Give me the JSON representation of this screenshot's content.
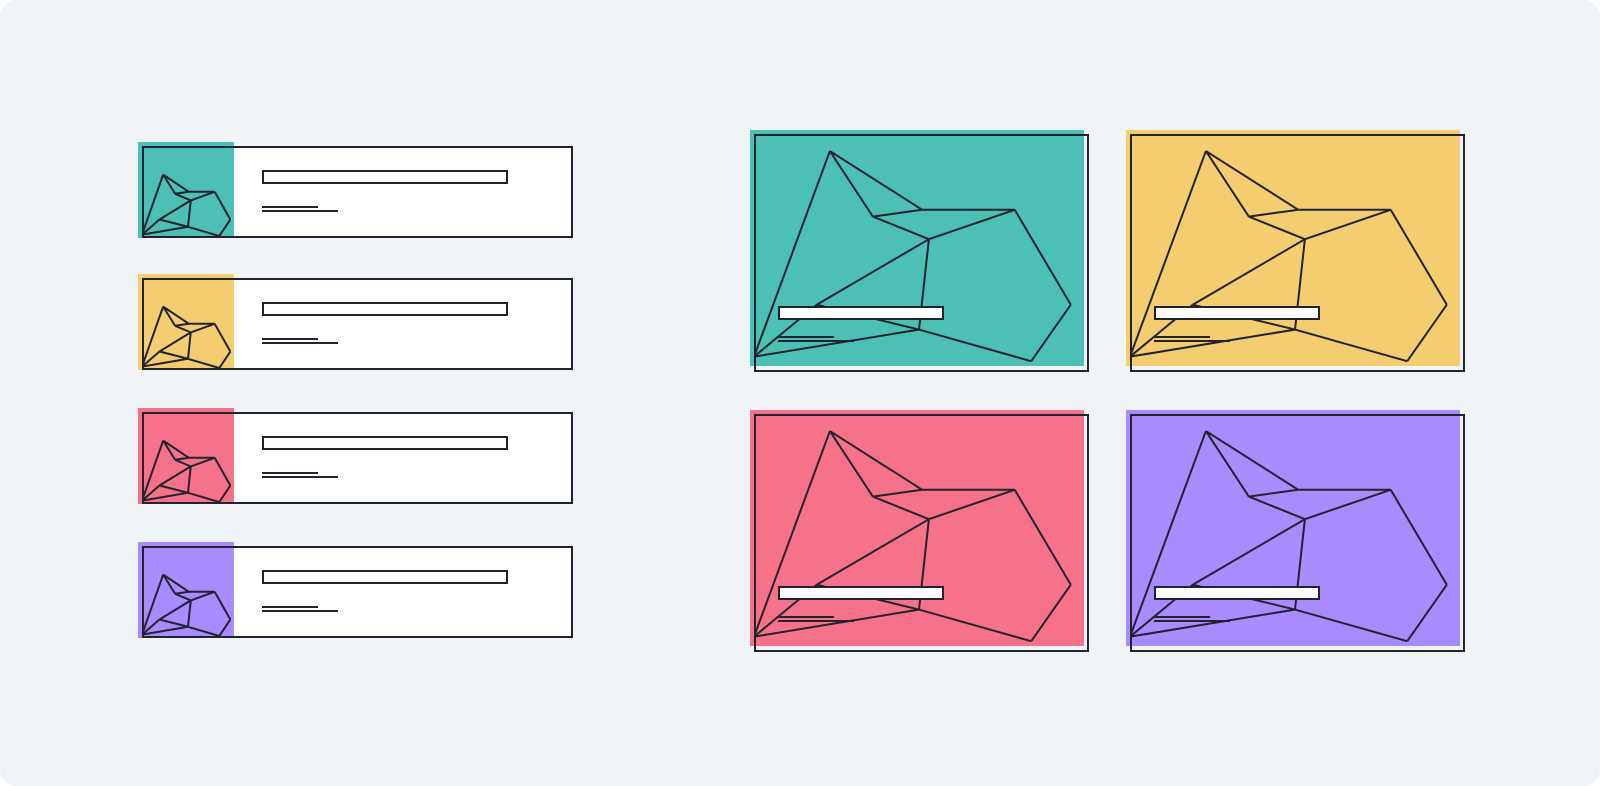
{
  "colors": {
    "background": "#f0f4f7",
    "outline": "#23232f",
    "teal": "#4cc0b5",
    "yellow": "#f3cd6f",
    "pink": "#f6718a",
    "purple": "#a88bfc"
  },
  "list_view": {
    "items": [
      {
        "color": "teal",
        "icon": "low-poly-bird-icon"
      },
      {
        "color": "yellow",
        "icon": "low-poly-bird-icon"
      },
      {
        "color": "pink",
        "icon": "low-poly-bird-icon"
      },
      {
        "color": "purple",
        "icon": "low-poly-bird-icon"
      }
    ]
  },
  "grid_view": {
    "items": [
      {
        "color": "teal",
        "icon": "low-poly-bird-icon"
      },
      {
        "color": "yellow",
        "icon": "low-poly-bird-icon"
      },
      {
        "color": "pink",
        "icon": "low-poly-bird-icon"
      },
      {
        "color": "purple",
        "icon": "low-poly-bird-icon"
      }
    ]
  }
}
